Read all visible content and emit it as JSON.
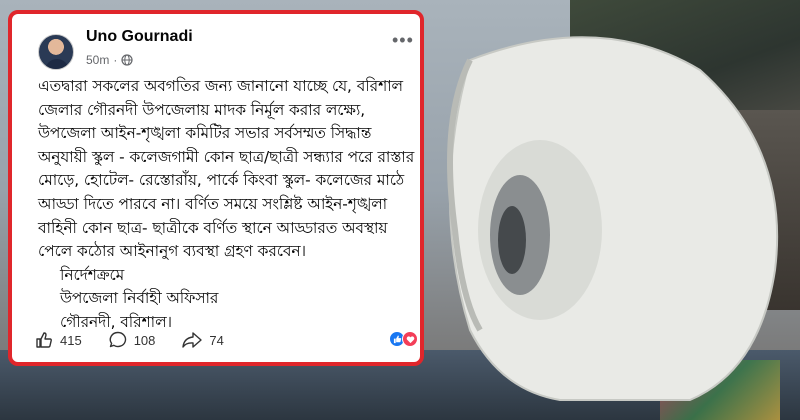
{
  "post": {
    "author": "Uno Gournadi",
    "time": "50m",
    "lines": [
      "এতদ্বারা সকলের অবগতির জন্য জানানো যাচ্ছে যে, বরিশাল",
      "জেলার গৌরনদী উপজেলায় মাদক নির্মূল করার লক্ষ্যে,",
      "উপজেলা আইন-শৃঙ্খলা কমিটির সভার সর্বসম্মত সিদ্ধান্ত",
      "অনুযায়ী স্কুল - কলেজগামী কোন ছাত্র/ছাত্রী সন্ধ্যার পরে রাস্তার",
      "মোড়ে, হোটেল- রেস্তোরাঁয়, পার্কে কিংবা স্কুল- কলেজের মাঠে",
      "আড্ডা দিতে পারবে না। বর্ণিত সময়ে সংশ্লিষ্ট আইন-শৃঙ্খলা",
      "বাহিনী কোন ছাত্র- ছাত্রীকে বর্ণিত স্থানে আড্ডারত অবস্থায়",
      "পেলে কঠোর আইনানুগ ব্যবস্থা গ্রহণ করবেন।"
    ],
    "signature": [
      "নির্দেশক্রমে",
      "উপজেলা নির্বাহী অফিসার",
      "গৌরনদী, বরিশাল।"
    ],
    "likes": "415",
    "comments": "108",
    "shares": "74"
  },
  "colors": {
    "frame": "#e0262b",
    "like": "#1877f2",
    "love": "#f33e58"
  }
}
